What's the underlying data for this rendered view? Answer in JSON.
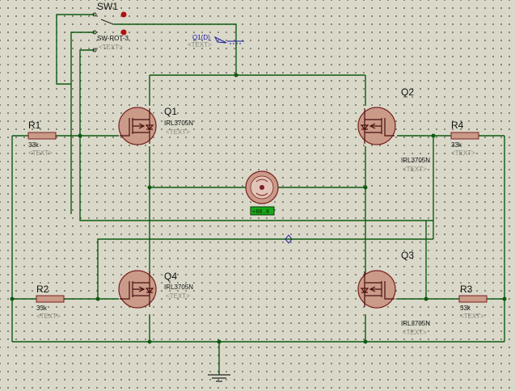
{
  "switch": {
    "ref": "SW1",
    "part": "SW-ROT-3",
    "text": "<TEXT>"
  },
  "probe": {
    "label": "Q1(D)",
    "text": "<TEXT>"
  },
  "mosfets": [
    {
      "ref": "Q1",
      "part": "IRL3705N",
      "text": "<TEXT>"
    },
    {
      "ref": "Q2",
      "part": "IRL3705N",
      "text": "<TEXT>"
    },
    {
      "ref": "Q3",
      "part": "IRL3705N",
      "text": "<TEXT>"
    },
    {
      "ref": "Q4",
      "part": "IRL3705N",
      "text": "<TEXT>"
    }
  ],
  "resistors": [
    {
      "ref": "R1",
      "value": "33k",
      "text": "<TEXT>"
    },
    {
      "ref": "R2",
      "value": "33k",
      "text": "<TEXT>"
    },
    {
      "ref": "R3",
      "value": "33k",
      "text": "<TEXT>"
    },
    {
      "ref": "R4",
      "value": "33k",
      "text": "<TEXT>"
    }
  ],
  "motor": {
    "readout": "+88.8"
  },
  "colors": {
    "wire": "#0d5a10",
    "component": "#c99b88",
    "outline": "#7a1f1f",
    "background": "#d9d8c9",
    "probe": "#1a1aa8"
  }
}
